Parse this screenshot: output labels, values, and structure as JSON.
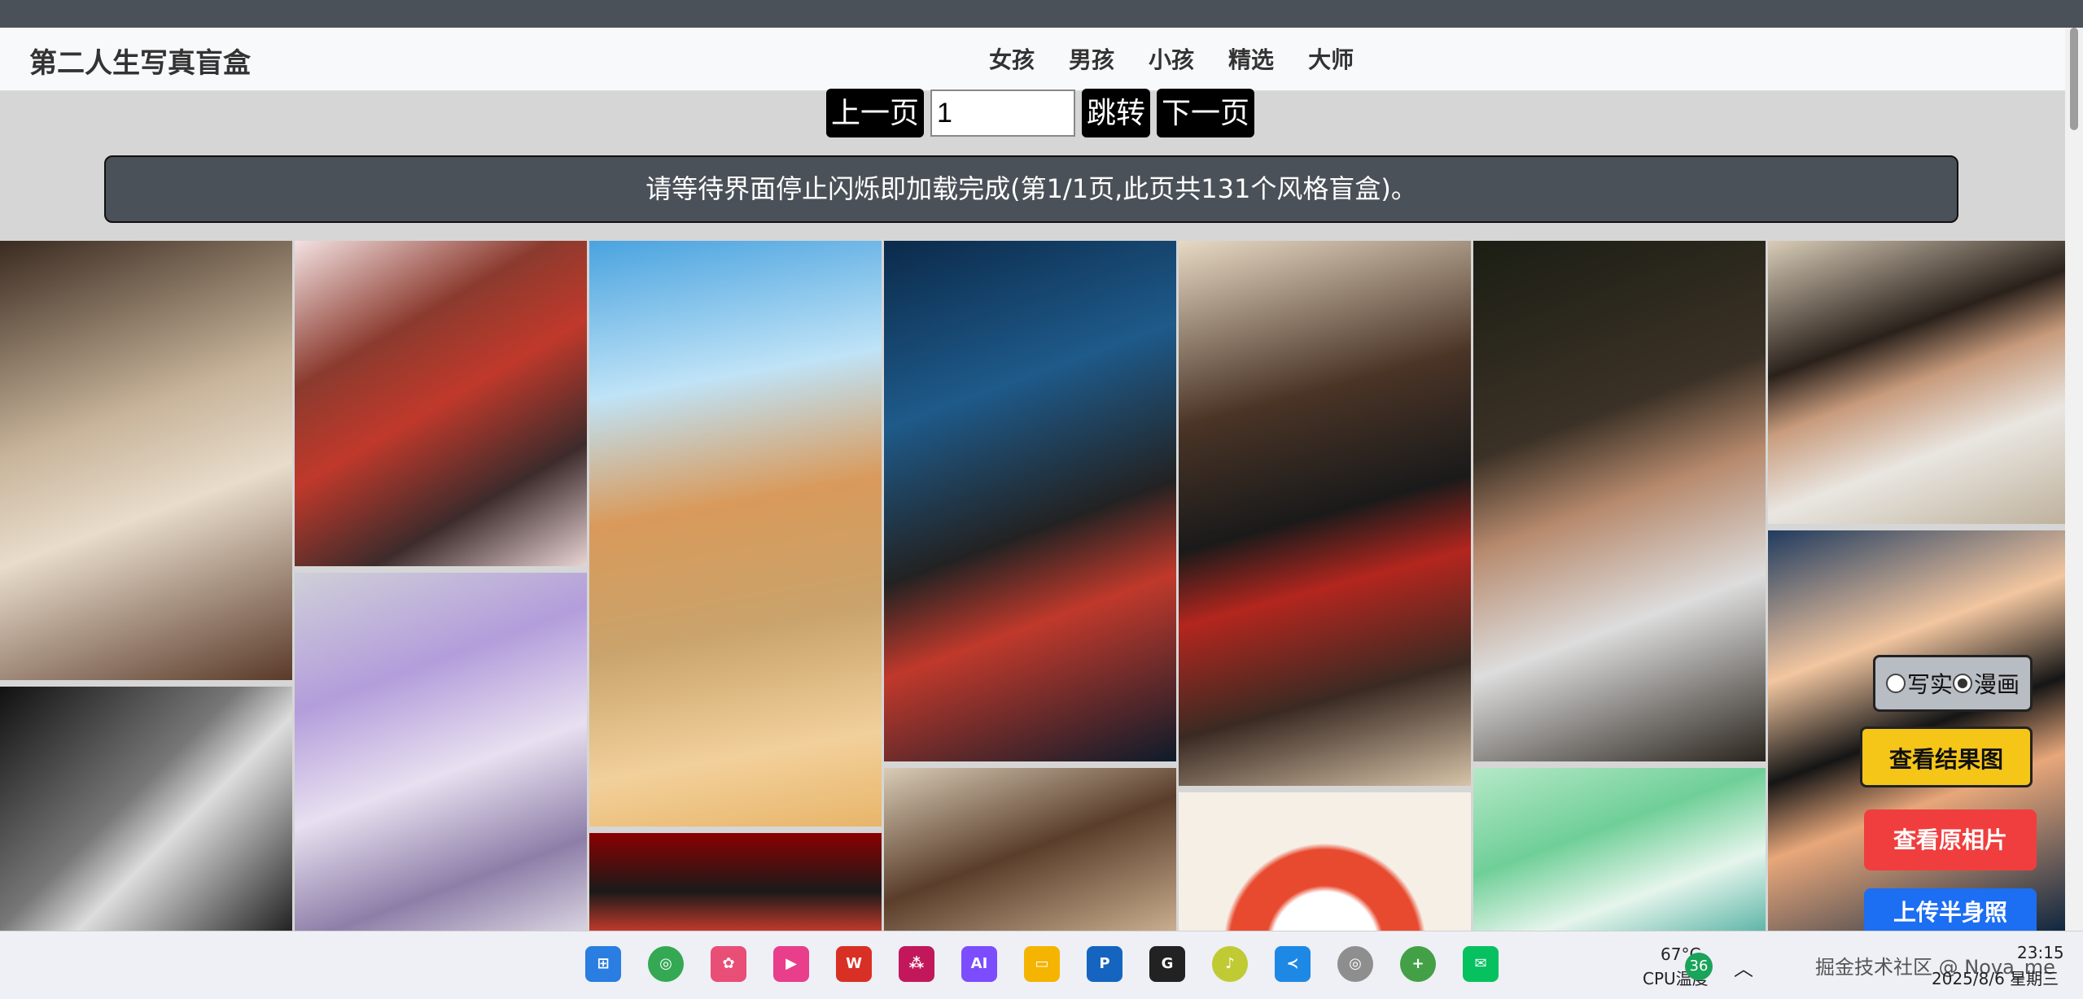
{
  "site": {
    "title": "第二人生写真盲盒"
  },
  "nav": {
    "links": [
      "女孩",
      "男孩",
      "小孩",
      "精选",
      "大师"
    ]
  },
  "pager": {
    "prev": "上一页",
    "page_value": "1",
    "jump": "跳转",
    "next": "下一页"
  },
  "banner": {
    "text": "请等待界面停止闪烁即加载完成(第1/1页,此页共131个风格盲盒)。"
  },
  "mode": {
    "option_real": "写实",
    "option_anime": "漫画",
    "selected": "漫画"
  },
  "actions": {
    "view_result": "查看结果图",
    "view_original": "查看原相片",
    "upload_half": "上传半身照"
  },
  "colors": {
    "accent_yellow": "#f5c518",
    "accent_red": "#f03e3e",
    "accent_blue": "#1c6ef2",
    "dark": "#4b5158"
  },
  "taskbar": {
    "apps": [
      {
        "name": "windows-start-icon",
        "color": "#2a7de1"
      },
      {
        "name": "chrome-icon",
        "color": "#34a853"
      },
      {
        "name": "app-flower-icon",
        "color": "#e94e77"
      },
      {
        "name": "app-pink-icon",
        "color": "#e83e8c"
      },
      {
        "name": "wps-icon",
        "color": "#d93025"
      },
      {
        "name": "app-dots-icon",
        "color": "#c2185b"
      },
      {
        "name": "ai-icon",
        "color": "#7c4dff"
      },
      {
        "name": "file-explorer-icon",
        "color": "#f4b400"
      },
      {
        "name": "app-p-icon",
        "color": "#1565c0"
      },
      {
        "name": "app-g-icon",
        "color": "#222222"
      },
      {
        "name": "music-icon",
        "color": "#c0ca33"
      },
      {
        "name": "vscode-icon",
        "color": "#1e88e5"
      },
      {
        "name": "chrome-profile-icon",
        "color": "#8e8e8e"
      },
      {
        "name": "app-plus-icon",
        "color": "#43a047"
      },
      {
        "name": "wechat-icon",
        "color": "#07c160"
      }
    ],
    "temp": "67°C",
    "cpu_label": "CPU温度",
    "badge": "36",
    "watermark": "掘金技术社区 @ Nova_me",
    "time": "23:15",
    "date": "2025/8/6 星期三"
  }
}
